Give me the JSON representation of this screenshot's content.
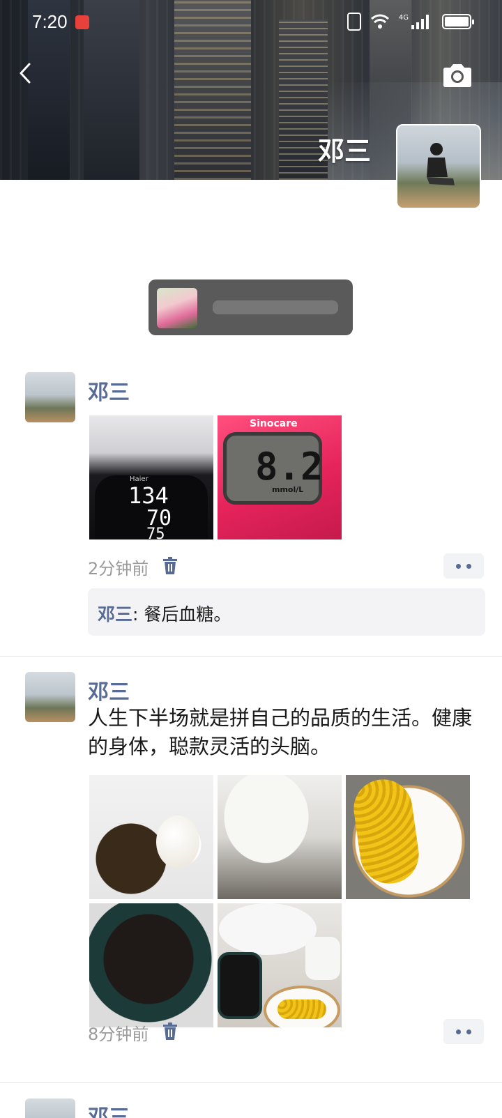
{
  "status_bar": {
    "time": "7:20",
    "network": "4G"
  },
  "header": {
    "profile_name": "邓三"
  },
  "posts": [
    {
      "author": "邓三",
      "text": "",
      "photos": [
        "blood-pressure-monitor",
        "glucose-meter"
      ],
      "glucose_brand": "Sinocare",
      "glucose_reading": "8.2",
      "glucose_unit": "mmol/L",
      "bp_brand": "Haier",
      "bp_values": [
        "134",
        "70",
        "75"
      ],
      "time": "2分钟前",
      "comment": {
        "name": "邓三",
        "text": ": 餐后血糖。"
      }
    },
    {
      "author": "邓三",
      "text": "人生下半场就是拼自己的品质的生活。健康的身体，聪款灵活的头脑。",
      "photos": [
        "food-plate",
        "yogurt",
        "corn",
        "coffee",
        "breakfast-table"
      ],
      "time": "8分钟前"
    },
    {
      "author": "邓三"
    }
  ]
}
